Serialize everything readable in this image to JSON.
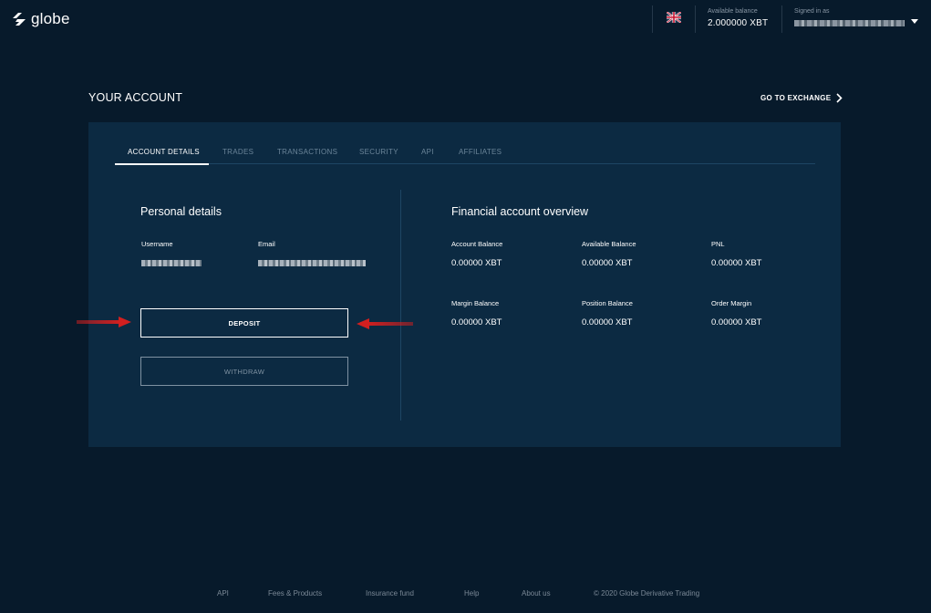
{
  "header": {
    "logo_text": "globe",
    "balance_label": "Available balance",
    "balance_value": "2.000000 XBT",
    "signed_in_label": "Signed in as"
  },
  "page": {
    "title": "YOUR ACCOUNT",
    "go_to_exchange": "GO TO EXCHANGE"
  },
  "tabs": [
    {
      "label": "ACCOUNT DETAILS",
      "active": true
    },
    {
      "label": "TRADES"
    },
    {
      "label": "TRANSACTIONS"
    },
    {
      "label": "SECURITY"
    },
    {
      "label": "API"
    },
    {
      "label": "AFFILIATES"
    }
  ],
  "personal": {
    "title": "Personal details",
    "username_label": "Username",
    "email_label": "Email",
    "deposit_label": "DEPOSIT",
    "withdraw_label": "WITHDRAW"
  },
  "financial": {
    "title": "Financial account overview",
    "items": [
      {
        "label": "Account Balance",
        "value": "0.00000 XBT"
      },
      {
        "label": "Available Balance",
        "value": "0.00000 XBT"
      },
      {
        "label": "PNL",
        "value": "0.00000 XBT"
      },
      {
        "label": "Margin Balance",
        "value": "0.00000 XBT"
      },
      {
        "label": "Position Balance",
        "value": "0.00000 XBT"
      },
      {
        "label": "Order Margin",
        "value": "0.00000 XBT"
      }
    ]
  },
  "footer": {
    "links": [
      "API",
      "Fees & Products",
      "Insurance fund",
      "Help",
      "About us"
    ],
    "copyright": "© 2020 Globe Derivative Trading"
  },
  "colors": {
    "background": "#071a2b",
    "card": "#0c2a42",
    "annotation_arrow": "#d21f1f"
  },
  "icons": [
    "globe-logo-icon",
    "uk-flag-icon",
    "chevron-down-icon",
    "chevron-right-icon",
    "red-arrow-annotation"
  ]
}
